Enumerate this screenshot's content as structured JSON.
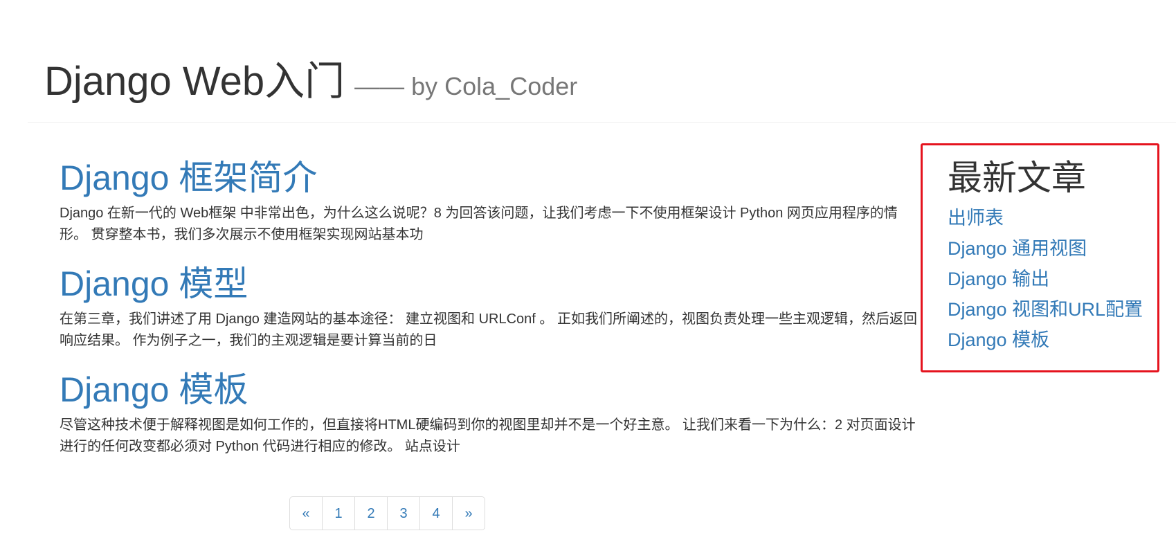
{
  "header": {
    "title": "Django Web入门",
    "subtitle": "—— by Cola_Coder"
  },
  "articles": [
    {
      "title": "Django 框架简介",
      "excerpt": "Django 在新一代的 Web框架 中非常出色，为什么这么说呢？8 为回答该问题，让我们考虑一下不使用框架设计 Python 网页应用程序的情形。 贯穿整本书，我们多次展示不使用框架实现网站基本功"
    },
    {
      "title": "Django 模型",
      "excerpt": "在第三章，我们讲述了用 Django 建造网站的基本途径： 建立视图和 URLConf 。 正如我们所阐述的，视图负责处理一些主观逻辑，然后返回响应结果。 作为例子之一，我们的主观逻辑是要计算当前的日"
    },
    {
      "title": "Django 模板",
      "excerpt": "尽管这种技术便于解释视图是如何工作的，但直接将HTML硬编码到你的视图里却并不是一个好主意。 让我们来看一下为什么：2 对页面设计进行的任何改变都必须对 Python 代码进行相应的修改。 站点设计"
    }
  ],
  "pagination": {
    "prev": "«",
    "pages": [
      "1",
      "2",
      "3",
      "4"
    ],
    "next": "»"
  },
  "sidebar": {
    "title": "最新文章",
    "links": [
      "出师表",
      "Django 通用视图",
      "Django 输出",
      "Django 视图和URL配置",
      "Django 模板"
    ],
    "highlight_color": "#e5131e"
  },
  "colors": {
    "link": "#337ab7",
    "text": "#333333",
    "muted": "#777777"
  }
}
